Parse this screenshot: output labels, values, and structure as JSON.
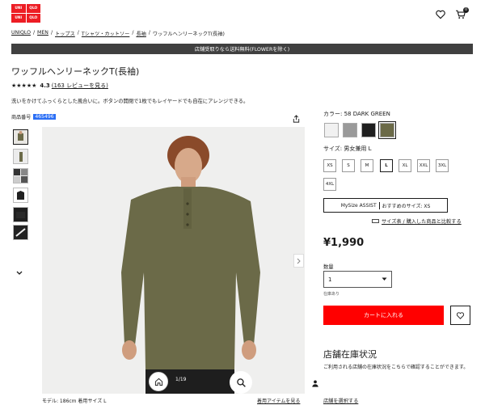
{
  "header": {
    "logo_text": [
      "UNI",
      "QLO",
      "UNI",
      "QLO"
    ],
    "bag_count": "0"
  },
  "breadcrumb": [
    "UNIQLO",
    "/",
    "MEN",
    "/",
    "トップス",
    "/",
    "Tシャツ・カットソー",
    "/",
    "長袖",
    "/",
    "ワッフルヘンリーネックT(長袖)"
  ],
  "banner": "店舗受取りなら送料無料(FLOWERを除く)",
  "product": {
    "title": "ワッフルヘンリーネックT(長袖)",
    "stars": "★★★★★",
    "rating": "4.3",
    "reviews": "(163 レビューを見る)",
    "description": "洗いをかけてふっくらとした風合いに。ボタンの開閉で1枚でもレイヤードでも自在にアレンジできる。",
    "pno_label": "商品番号",
    "pno_value": "465496",
    "slide_count": "1/19",
    "model_info": "モデル: 186cm 着用サイズ L",
    "model_link": "着用アイテムを見る"
  },
  "options": {
    "color_label": "カラー: 58 DARK GREEN",
    "colors": [
      "#f1f1f1",
      "#9a9a9a",
      "#1f1f1f",
      "#6b6a48"
    ],
    "size_label": "サイズ: 男女兼用 L",
    "sizes": [
      "XS",
      "S",
      "M",
      "L",
      "XL",
      "XXL",
      "3XL",
      "4XL"
    ],
    "selected_size": "L",
    "mysize_label": "MySize ASSIST",
    "mysize_reco": "おすすめのサイズ: XS",
    "compare_link": "サイズ表 / 購入した商品と比較する"
  },
  "purchase": {
    "price": "¥1,990",
    "qty_label": "数量",
    "qty_value": "1",
    "stock_note": "在庫あり",
    "cart_label": "カートに入れる"
  },
  "store": {
    "title": "店舗在庫状況",
    "desc": "ご利用される店舗の在庫状況をこちらで確認することができます。",
    "link": "店舗を選択する"
  },
  "colors": {
    "brand_red": "#ed1d24",
    "cart_red": "#ff0000",
    "shirt_green": "#6b6a48"
  }
}
